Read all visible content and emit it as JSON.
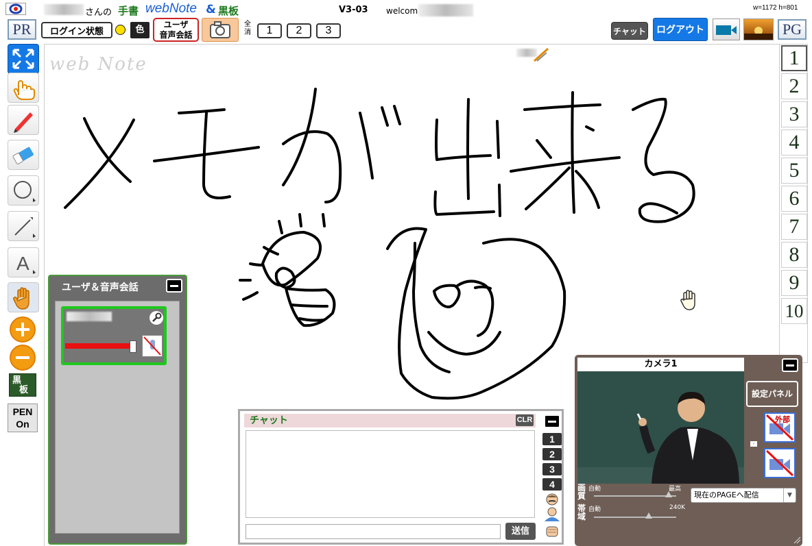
{
  "header": {
    "user_suffix": "さんの",
    "title_hand": "手書",
    "title_webnote": "webNote",
    "title_amp": "&",
    "title_board": "黒板",
    "version": "V3-03",
    "welcome": "welcom",
    "dims": "w=1172 h=801",
    "pr_label": "PR",
    "login_state_label": "ログイン状態",
    "color_label": "色",
    "user_voice_label_1": "ユーザ",
    "user_voice_label_2": "音声会話",
    "clear_all_1": "全",
    "clear_all_2": "消",
    "num_buttons": [
      "1",
      "2",
      "3"
    ],
    "chat_button": "チャット",
    "logout_button": "ログアウト",
    "pg_label": "PG"
  },
  "toolbar": {
    "board_label_1": "黒",
    "board_label_2": "板",
    "pen_label_1": "PEN",
    "pen_label_2": "On"
  },
  "canvas": {
    "watermark": "web Note"
  },
  "pages": [
    "1",
    "2",
    "3",
    "4",
    "5",
    "6",
    "7",
    "8",
    "9",
    "10"
  ],
  "user_panel": {
    "title": "ユーザ＆音声会話"
  },
  "chat": {
    "title": "チャット",
    "clear_button": "CLR",
    "channel_buttons": [
      "1",
      "2",
      "3",
      "4"
    ],
    "send_button": "送信",
    "input_value": ""
  },
  "camera": {
    "title": "カメラ1",
    "settings_button": "設定パネル",
    "external_label": "外部",
    "quality_label_1": "画",
    "quality_label_2": "質",
    "quality_auto": "自動",
    "quality_max": "最高",
    "band_label_1": "帯",
    "band_label_2": "域",
    "band_auto": "自動",
    "band_value": "240K",
    "distribute_select": "現在のPAGEへ配信",
    "level_marker": "-"
  },
  "colors": {
    "accent_blue": "#1479e6",
    "green_frame": "#1ec81e",
    "orange": "#f39c12",
    "chat_title_bg": "#eed8da"
  }
}
